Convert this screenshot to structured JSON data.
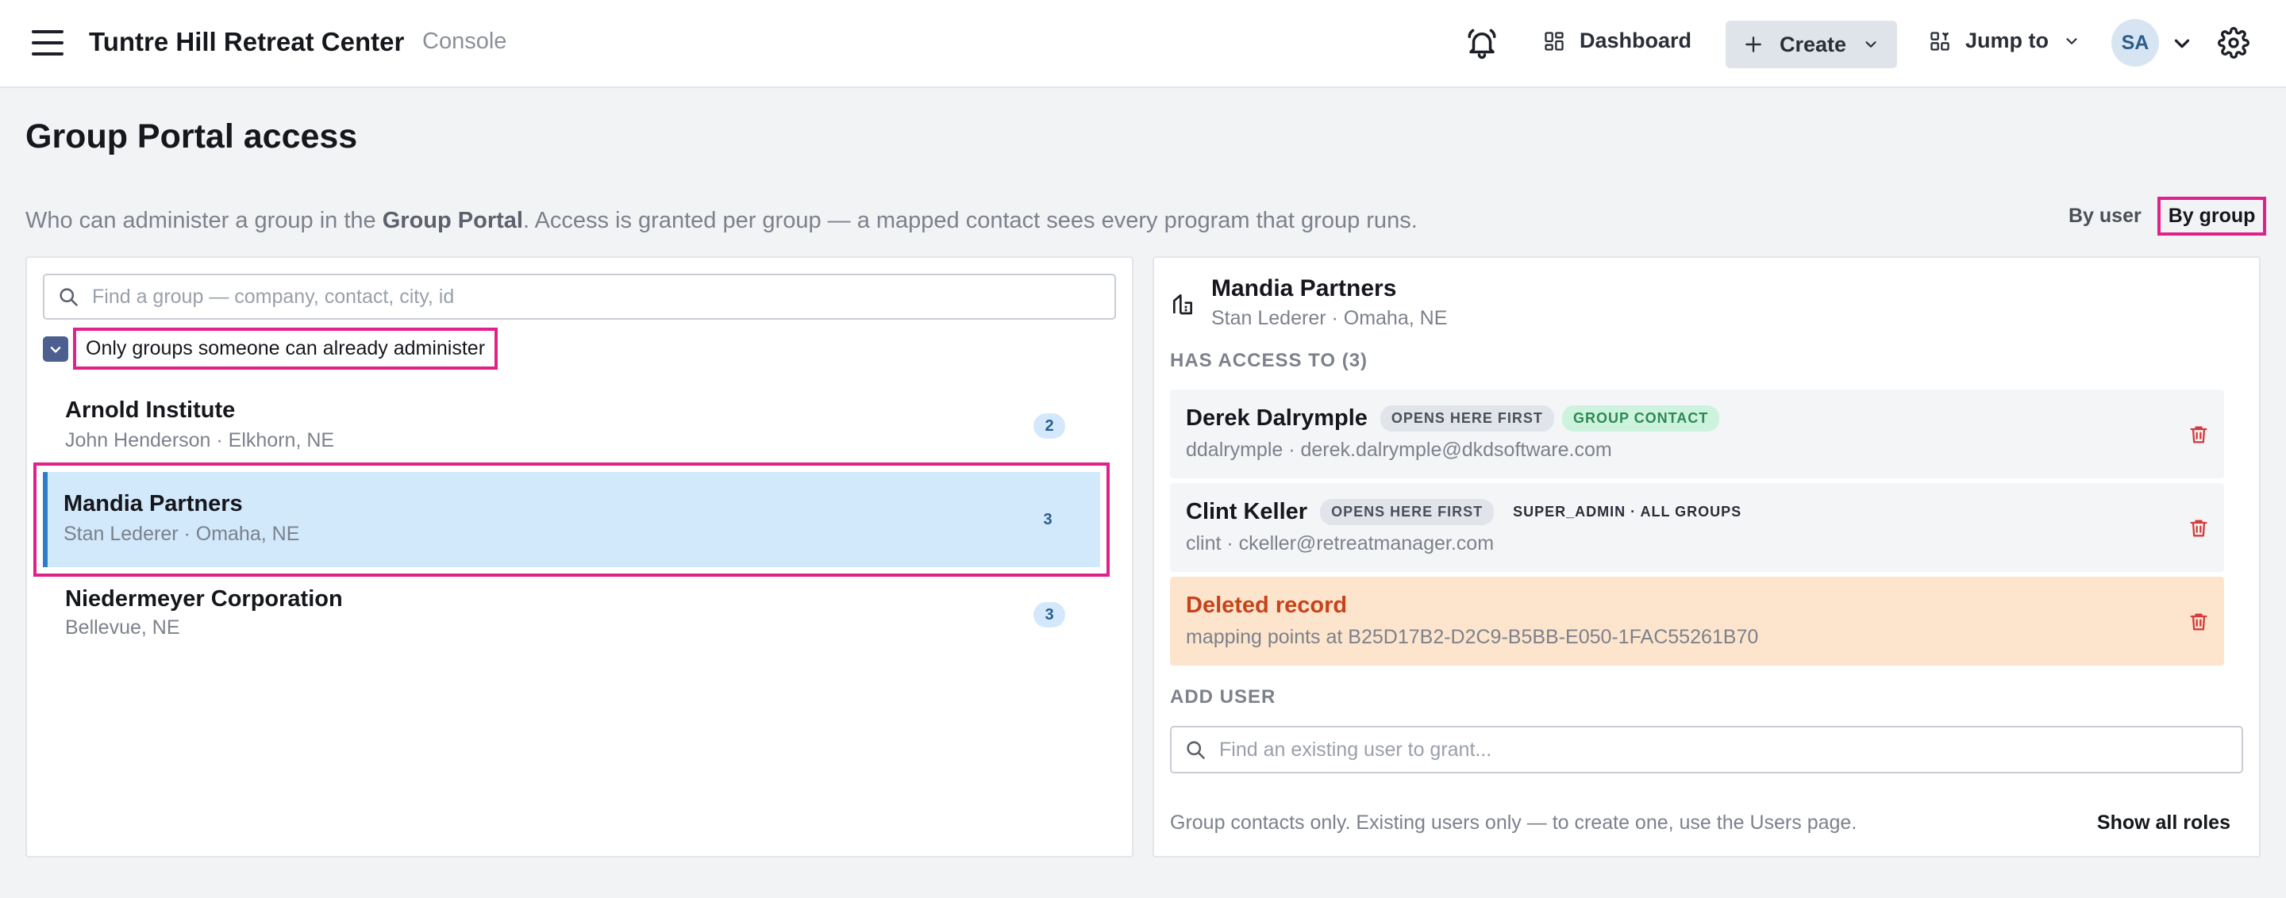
{
  "header": {
    "app_title": "Tuntre Hill Retreat Center",
    "app_subtitle": "Console",
    "dashboard_label": "Dashboard",
    "create_label": "Create",
    "jump_label": "Jump to",
    "avatar_initials": "SA"
  },
  "page": {
    "title": "Group Portal access",
    "desc_prefix": "Who can administer a group in the ",
    "desc_bold": "Group Portal",
    "desc_suffix": ". Access is granted per group — a mapped contact sees every program that group runs.",
    "view_by_user": "By user",
    "view_by_group": "By group",
    "active_view": "By group"
  },
  "groups_panel": {
    "search_placeholder": "Find a group — company, contact, city, id",
    "filter_label": "Only groups someone can already administer",
    "filter_checked": true,
    "groups": [
      {
        "name": "Arnold Institute",
        "sub": "John Henderson · Elkhorn, NE",
        "count": "2"
      },
      {
        "name": "Mandia Partners",
        "sub": "Stan Lederer · Omaha, NE",
        "count": "3",
        "selected": true
      },
      {
        "name": "Niedermeyer Corporation",
        "sub": "Bellevue, NE",
        "count": "3"
      }
    ]
  },
  "detail_panel": {
    "title": "Mandia Partners",
    "sub": "Stan Lederer · Omaha, NE",
    "access_heading": "HAS ACCESS TO (3)",
    "users": [
      {
        "name": "Derek Dalrymple",
        "tags": [
          "OPENS HERE FIRST",
          "GROUP CONTACT"
        ],
        "sub": "ddalrymple · derek.dalrymple@dkdsoftware.com"
      },
      {
        "name": "Clint Keller",
        "tags": [
          "OPENS HERE FIRST",
          "SUPER_ADMIN · ALL GROUPS"
        ],
        "sub": "clint · ckeller@retreatmanager.com"
      },
      {
        "name": "Deleted record",
        "tags": [],
        "sub": "mapping points at B25D17B2-D2C9-B5BB-E050-1FAC55261B70",
        "deleted": true
      }
    ],
    "add_heading": "ADD USER",
    "user_search_placeholder": "Find an existing user to grant...",
    "footer_note": "Group contacts only. Existing users only — to create one, use the Users page.",
    "show_roles_label": "Show all roles"
  },
  "colors": {
    "highlight": "#e0218a",
    "selected_bg": "#d2e8fb",
    "accent": "#2f7dc9",
    "deleted_bg": "#fde5cd",
    "danger": "#d63b3b"
  },
  "icons": [
    "menu-icon",
    "bell-icon",
    "dashboard-icon",
    "plus-icon",
    "chevron-down-icon",
    "jump-icon",
    "gear-icon",
    "search-icon",
    "check-icon",
    "building-icon",
    "trash-icon"
  ]
}
